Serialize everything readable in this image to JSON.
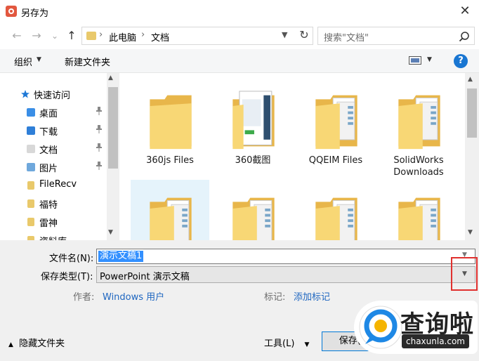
{
  "window": {
    "title": "另存为",
    "close_glyph": "✕"
  },
  "nav": {
    "back_glyph": "←",
    "forward_glyph": "→",
    "recent_glyph": "⌄",
    "up_glyph": "↑",
    "address": {
      "sep": "›",
      "pc": "此电脑",
      "docs": "文档"
    },
    "refresh_glyph": "↻",
    "search_placeholder": "搜索\"文档\""
  },
  "toolbar": {
    "organize": "组织",
    "new_folder": "新建文件夹",
    "help": "?"
  },
  "sidebar": {
    "quick_access": "快速访问",
    "items": [
      {
        "label": "桌面",
        "icon": "desktop-icon",
        "pinned": true
      },
      {
        "label": "下载",
        "icon": "download-icon",
        "pinned": true
      },
      {
        "label": "文档",
        "icon": "documents-icon",
        "pinned": true
      },
      {
        "label": "图片",
        "icon": "pictures-icon",
        "pinned": true
      },
      {
        "label": "FileRecv",
        "icon": "folder-icon",
        "pinned": false
      },
      {
        "label": "福特",
        "icon": "folder-icon",
        "pinned": false
      },
      {
        "label": "雷神",
        "icon": "folder-icon",
        "pinned": false
      },
      {
        "label": "资料库",
        "icon": "folder-icon",
        "pinned": false
      }
    ],
    "pin_glyph": "📌"
  },
  "files": [
    {
      "name": "360js Files",
      "type": "empty-folder"
    },
    {
      "name": "360截图",
      "type": "image-folder"
    },
    {
      "name": "QQEIM Files",
      "type": "doc-folder"
    },
    {
      "name": "SolidWorks Downloads",
      "type": "doc-folder"
    },
    {
      "name": "",
      "type": "doc-folder",
      "selected": true
    },
    {
      "name": "",
      "type": "doc-folder"
    },
    {
      "name": "",
      "type": "doc-folder"
    },
    {
      "name": "",
      "type": "doc-folder"
    }
  ],
  "form": {
    "filename_label": "文件名(N):",
    "filename_value": "演示文稿1",
    "filetype_label": "保存类型(T):",
    "filetype_value": "PowerPoint 演示文稿",
    "author_label": "作者:",
    "author_value": "Windows 用户",
    "tags_label": "标记:",
    "tags_value": "添加标记"
  },
  "footer": {
    "hide_folders": "隐藏文件夹",
    "tools": "工具(L)",
    "save": "保存(S)"
  },
  "watermark": {
    "text": "查询啦",
    "url": "chaxunla.com"
  },
  "colors": {
    "accent": "#0078d7",
    "selection": "#3390ff",
    "folder": "#f5c65b",
    "highlight_box": "#e0302e"
  }
}
